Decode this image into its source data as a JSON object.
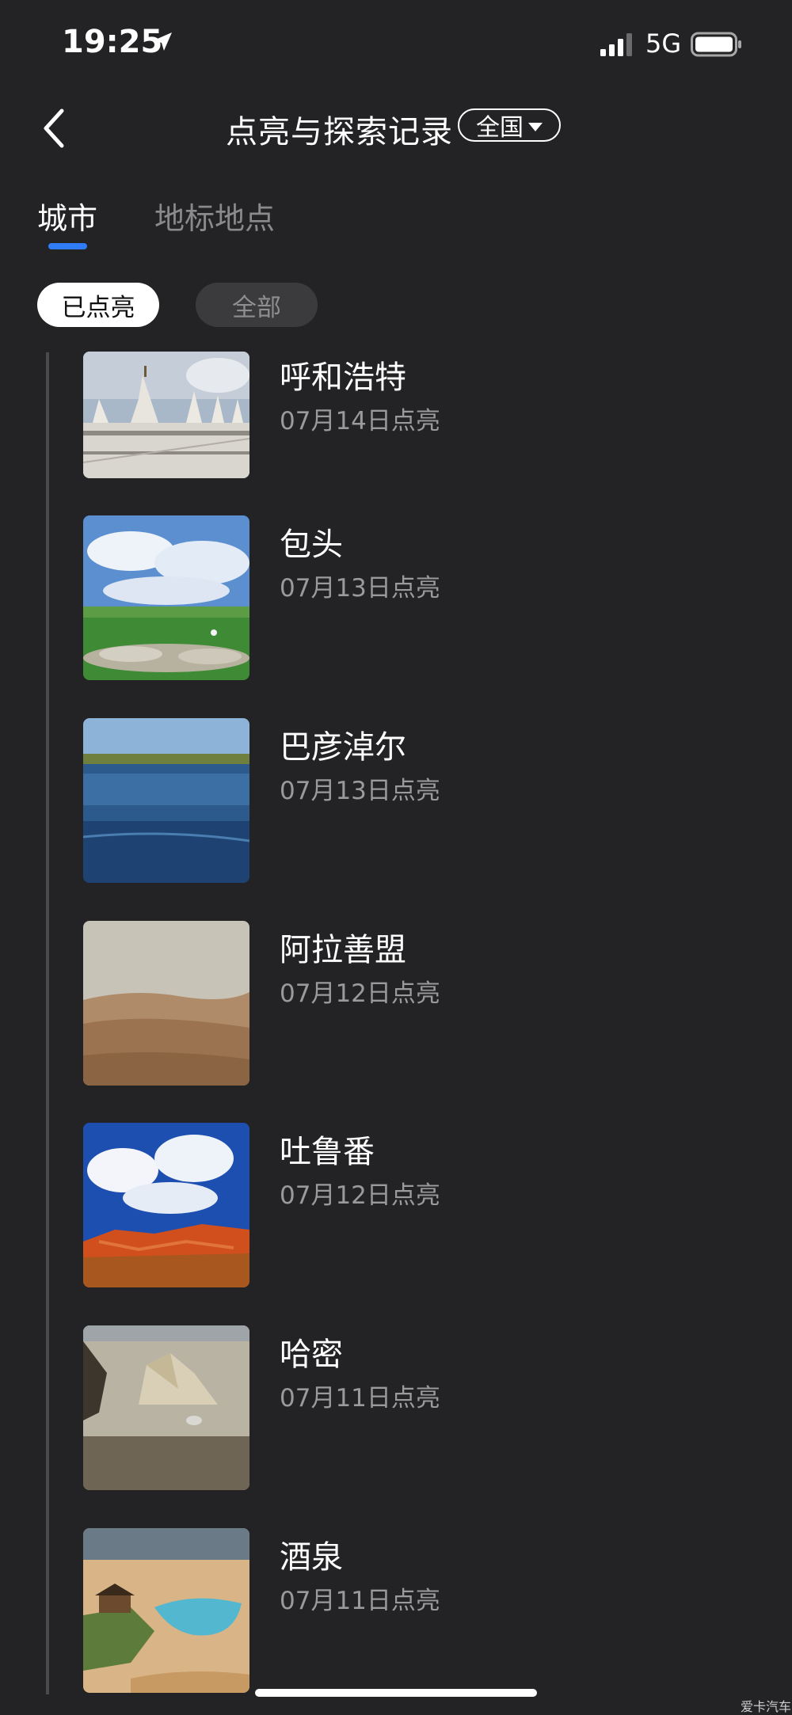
{
  "status": {
    "time": "19:25",
    "network": "5G"
  },
  "nav": {
    "title": "点亮与探索记录",
    "region": "全国"
  },
  "tabs": [
    {
      "label": "城市",
      "active": true
    },
    {
      "label": "地标地点",
      "active": false
    }
  ],
  "filters": [
    {
      "label": "已点亮",
      "selected": true
    },
    {
      "label": "全部",
      "selected": false
    }
  ],
  "records": [
    {
      "city": "呼和浩特",
      "date": "07月14日点亮",
      "image": "white stupa temple under cloudy sky"
    },
    {
      "city": "包头",
      "date": "07月13日点亮",
      "image": "grassland with sheep and clouds"
    },
    {
      "city": "巴彦淖尔",
      "date": "07月13日点亮",
      "image": "blue lake with reeds"
    },
    {
      "city": "阿拉善盟",
      "date": "07月12日点亮",
      "image": "desert hills"
    },
    {
      "city": "吐鲁番",
      "date": "07月12日点亮",
      "image": "red flaming mountains under blue sky"
    },
    {
      "city": "哈密",
      "date": "07月11日点亮",
      "image": "yardang rock formation"
    },
    {
      "city": "酒泉",
      "date": "07月11日点亮",
      "image": "crescent lake oasis in sand dunes"
    }
  ],
  "watermark": "爱卡汽车",
  "colors": {
    "background": "#232325",
    "accent": "#2f7cf6",
    "secondary_text": "#9a9a9c"
  }
}
